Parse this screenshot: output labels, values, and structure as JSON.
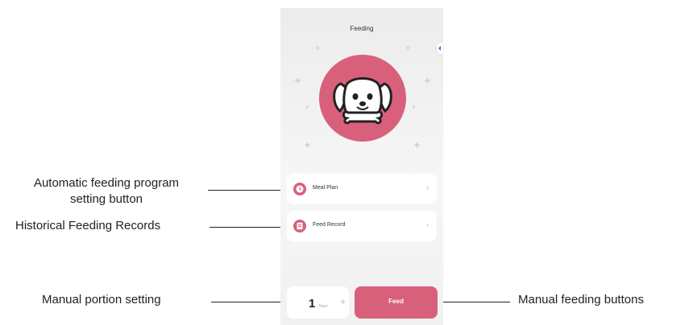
{
  "screen": {
    "title": "Feeding",
    "menu": [
      {
        "label": "Meal Plan",
        "icon": "clock-icon"
      },
      {
        "label": "Feed Record",
        "icon": "document-icon"
      }
    ],
    "portion": {
      "value": "1",
      "unit": "Num",
      "plus": "+"
    },
    "feed_button": "Feed"
  },
  "annotations": {
    "meal_plan_line1": "Automatic feeding program",
    "meal_plan_line2": "setting button",
    "feed_record": "Historical Feeding Records",
    "portion": "Manual portion setting",
    "feed_button": "Manual feeding buttons"
  },
  "colors": {
    "accent": "#d9607a",
    "background": "#f0f0f0",
    "card": "#ffffff"
  }
}
